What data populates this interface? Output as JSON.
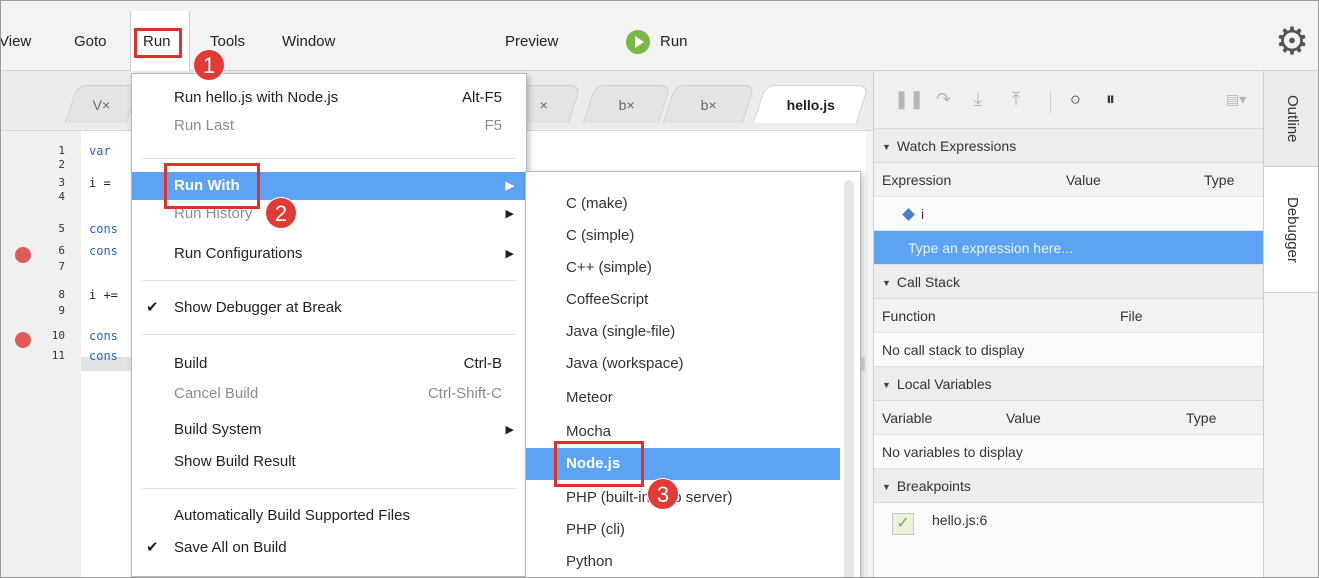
{
  "menubar": {
    "items": [
      "View",
      "Goto",
      "Run",
      "Tools",
      "Window"
    ],
    "preview": "Preview",
    "run_button": "Run"
  },
  "tabs": [
    "V×",
    "×",
    "b×",
    "b×",
    "hello.js"
  ],
  "editor": {
    "line_numbers": [
      "1",
      "2",
      "3",
      "4",
      "5",
      "6",
      "7",
      "8",
      "9",
      "10",
      "11"
    ],
    "code": [
      "var",
      "",
      "i =",
      "",
      "cons",
      "cons",
      "",
      "i +=",
      "",
      "cons",
      "cons"
    ],
    "breakpoint_lines": [
      6,
      10
    ],
    "current_line": 11
  },
  "run_menu": {
    "items": [
      {
        "label": "Run hello.js with Node.js",
        "shortcut": "Alt-F5"
      },
      {
        "label": "Run Last",
        "shortcut": "F5",
        "disabled": true
      },
      {
        "label": "Run With",
        "submenu": true,
        "selected": true
      },
      {
        "label": "Run History",
        "submenu": true,
        "disabled": true
      },
      {
        "label": "Run Configurations",
        "submenu": true
      },
      {
        "label": "Show Debugger at Break",
        "checked": true
      },
      {
        "label": "Build",
        "shortcut": "Ctrl-B"
      },
      {
        "label": "Cancel Build",
        "shortcut": "Ctrl-Shift-C",
        "disabled": true
      },
      {
        "label": "Build System",
        "submenu": true
      },
      {
        "label": "Show Build Result"
      },
      {
        "label": "Automatically Build Supported Files"
      },
      {
        "label": "Save All on Build",
        "checked": true
      }
    ]
  },
  "run_with_submenu": {
    "items": [
      "C (make)",
      "C (simple)",
      "C++ (simple)",
      "CoffeeScript",
      "Java (single-file)",
      "Java (workspace)",
      "Meteor",
      "Mocha",
      "Node.js",
      "PHP (built-in web server)",
      "PHP (cli)",
      "Python"
    ],
    "selected": "Node.js"
  },
  "debugger": {
    "watch": {
      "title": "Watch Expressions",
      "columns": [
        "Expression",
        "Value",
        "Type"
      ],
      "entries": [
        "i"
      ],
      "placeholder": "Type an expression here..."
    },
    "call_stack": {
      "title": "Call Stack",
      "columns": [
        "Function",
        "File"
      ],
      "empty": "No call stack to display"
    },
    "locals": {
      "title": "Local Variables",
      "columns": [
        "Variable",
        "Value",
        "Type"
      ],
      "empty": "No variables to display"
    },
    "breakpoints": {
      "title": "Breakpoints",
      "items": [
        "hello.js:6"
      ]
    }
  },
  "side_tabs": [
    "Outline",
    "Debugger"
  ],
  "annotations": [
    "1",
    "2",
    "3"
  ],
  "colors": {
    "accent": "#5ca3f3",
    "annotation_red": "#e0312f",
    "run_green": "#7ab648",
    "breakpoint_red": "#e05a57"
  },
  "icons": [
    "gear-icon",
    "play-icon",
    "file-tree-icon",
    "resume-icon",
    "step-over-icon",
    "step-into-icon",
    "step-out-icon",
    "breakpoint-toggle-icon",
    "pause-on-exception-icon",
    "panel-menu-icon"
  ]
}
